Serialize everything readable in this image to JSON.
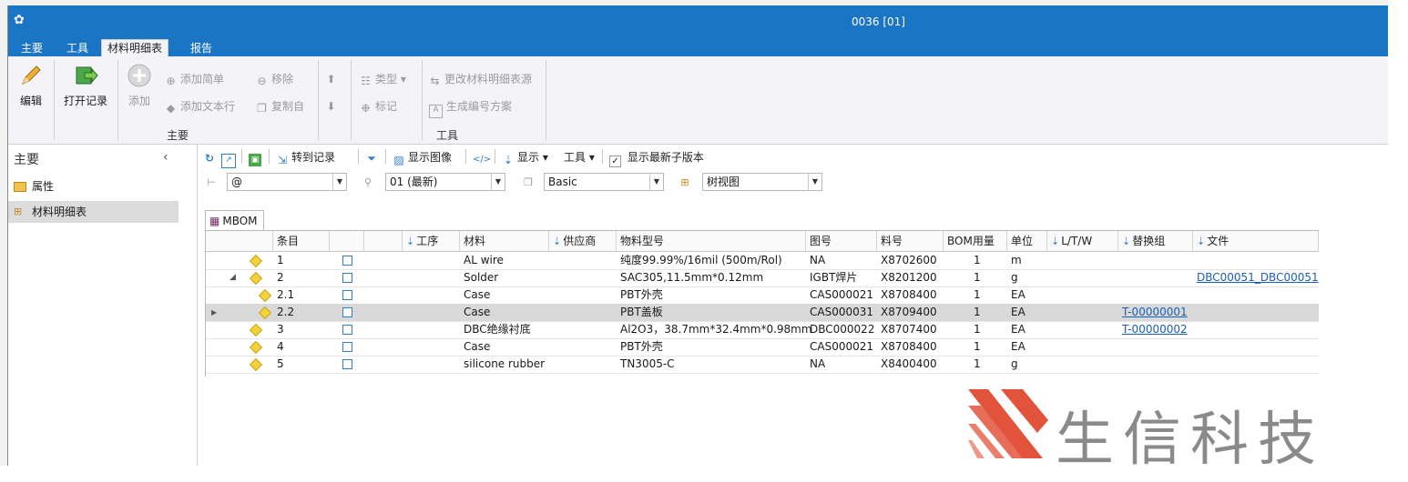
{
  "window": {
    "title": "0036 [01]",
    "app_icon": "app-icon"
  },
  "ribbon_tabs": [
    {
      "label": "主要"
    },
    {
      "label": "工具"
    },
    {
      "label": "材料明细表"
    },
    {
      "label": "报告"
    }
  ],
  "ribbon": {
    "edit_label": "编辑",
    "open_record_label": "打开记录",
    "add_label": "添加",
    "add_simple_label": "添加简单",
    "add_text_row_label": "添加文本行",
    "remove_label": "移除",
    "copy_from_label": "复制自",
    "type_label": "类型",
    "mark_label": "标记",
    "change_source_label": "更改材料明细表源",
    "gen_numbering_label": "生成编号方案",
    "group_main": "主要",
    "group_tools": "工具"
  },
  "leftnav": {
    "header": "主要",
    "items": [
      {
        "label": "属性",
        "icon": "properties-icon"
      },
      {
        "label": "材料明细表",
        "icon": "bom-icon"
      }
    ]
  },
  "toolbar": {
    "goto_record": "转到记录",
    "show_image": "显示图像",
    "display": "显示",
    "tools": "工具",
    "show_latest_child": "显示最新子版本",
    "show_latest_checked": true
  },
  "filters": {
    "search_value": "@",
    "revision_value": "01 (最新)",
    "view_value": "Basic",
    "layout_value": "树视图"
  },
  "grid": {
    "tab_label": "MBOM",
    "columns": [
      "条目",
      "",
      "",
      "工序",
      "材料",
      "供应商",
      "物料型号",
      "图号",
      "料号",
      "BOM用量",
      "单位",
      "L/T/W",
      "替换组",
      "文件"
    ],
    "rows": [
      {
        "item": "1",
        "material": "AL wire",
        "model": "纯度99.99%/16mil (500m/Rol)",
        "drawing": "NA",
        "part": "X8702600",
        "qty": "1",
        "unit": "m",
        "alt": "",
        "file": ""
      },
      {
        "item": "2",
        "material": "Solder",
        "model": "SAC305,11.5mm*0.12mm",
        "drawing": "IGBT焊片",
        "part": "X8201200",
        "qty": "1",
        "unit": "g",
        "alt": "",
        "file": "DBC00051_DBC00051"
      },
      {
        "item": "2.1",
        "material": "Case",
        "model": "PBT外壳",
        "drawing": "CAS000021",
        "part": "X8708400",
        "qty": "1",
        "unit": "EA",
        "alt": "",
        "file": ""
      },
      {
        "item": "2.2",
        "material": "Case",
        "model": "PBT盖板",
        "drawing": "CAS000031",
        "part": "X8709400",
        "qty": "1",
        "unit": "EA",
        "alt": "T-00000001",
        "file": ""
      },
      {
        "item": "3",
        "material": "DBC绝缘衬底",
        "model": "Al2O3，38.7mm*32.4mm*0.98mm",
        "drawing": "DBC000022",
        "part": "X8707400",
        "qty": "1",
        "unit": "EA",
        "alt": "T-00000002",
        "file": ""
      },
      {
        "item": "4",
        "material": "Case",
        "model": "PBT外壳",
        "drawing": "CAS000021",
        "part": "X8708400",
        "qty": "1",
        "unit": "EA",
        "alt": "",
        "file": ""
      },
      {
        "item": "5",
        "material": "silicone rubber",
        "model": "TN3005-C",
        "drawing": "NA",
        "part": "X8400400",
        "qty": "1",
        "unit": "g",
        "alt": "",
        "file": ""
      }
    ],
    "selected_row": 3
  },
  "watermark": {
    "text": "生信科技",
    "logo_color": "#e2533c",
    "text_color": "#8a8a8a"
  },
  "colors": {
    "titlebar": "#1b75c5",
    "link": "#1a5fb4",
    "selected_row": "#d9d9d9"
  }
}
